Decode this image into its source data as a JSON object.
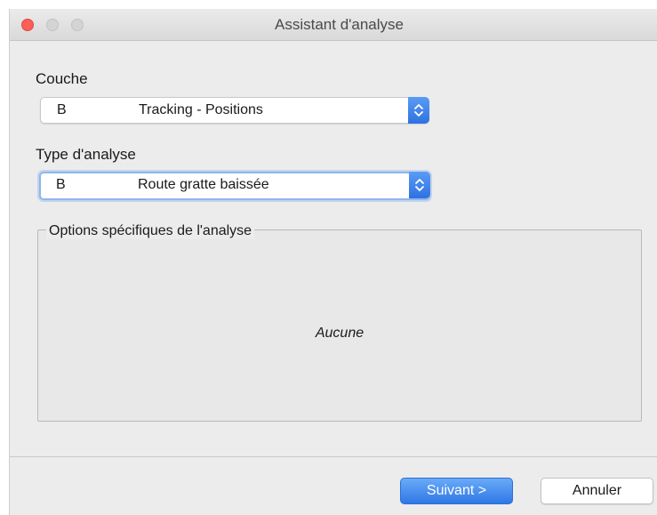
{
  "window": {
    "title": "Assistant d'analyse",
    "controls": [
      "close",
      "minimize",
      "zoom"
    ]
  },
  "layer": {
    "label": "Couche",
    "prefix": "B",
    "value": "Tracking - Positions"
  },
  "analysis_type": {
    "label": "Type d'analyse",
    "prefix": "B",
    "value": "Route gratte baissée"
  },
  "options": {
    "legend": "Options spécifiques de l'analyse",
    "empty_text": "Aucune"
  },
  "buttons": {
    "next_label": "Suivant >",
    "cancel_label": "Annuler"
  },
  "colors": {
    "accent": "#2f78e6",
    "close_button": "#fc5f57",
    "background": "#ececec"
  }
}
